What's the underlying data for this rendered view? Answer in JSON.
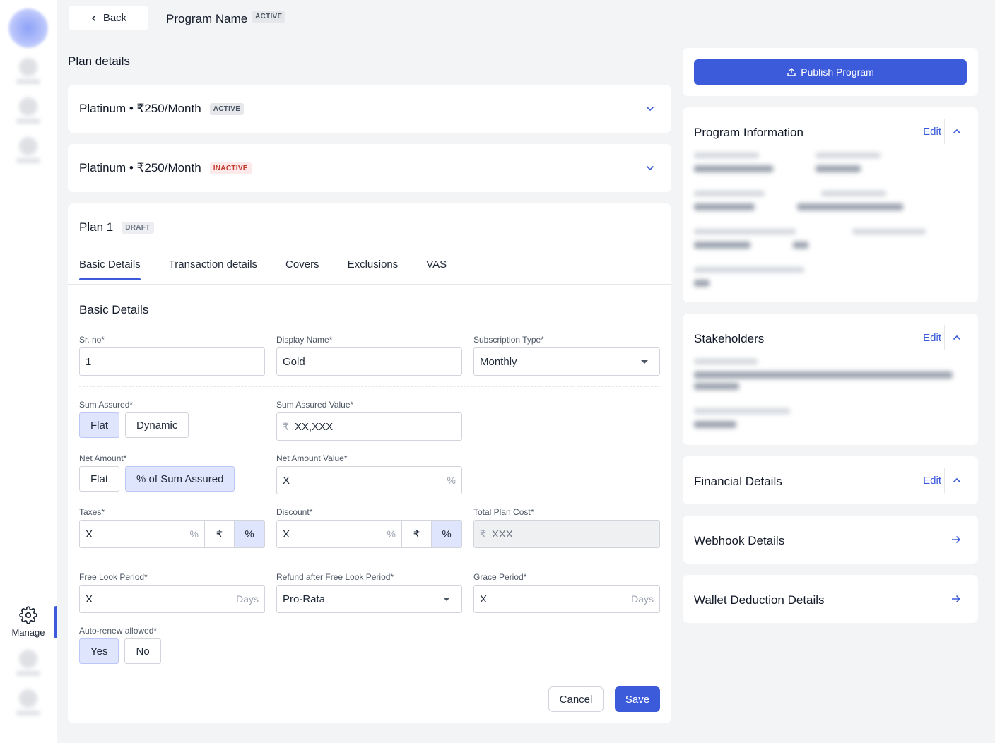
{
  "sidebar": {
    "manage_label": "Manage"
  },
  "header": {
    "back_label": "Back",
    "program_name": "Program Name",
    "program_status": "ACTIVE"
  },
  "plan_details": {
    "section_title": "Plan details",
    "plans": [
      {
        "name": "Platinum • ₹250/Month",
        "status": "ACTIVE"
      },
      {
        "name": "Platinum • ₹250/Month",
        "status": "INACTIVE"
      }
    ]
  },
  "plan1": {
    "title": "Plan 1",
    "status": "DRAFT",
    "tabs": [
      "Basic Details",
      "Transaction details",
      "Covers",
      "Exclusions",
      "VAS"
    ],
    "active_tab": "Basic Details",
    "section_title": "Basic Details",
    "fields": {
      "sr_no": {
        "label": "Sr. no*",
        "value": "1"
      },
      "display_name": {
        "label": "Display Name*",
        "value": "Gold"
      },
      "subscription_type": {
        "label": "Subscription Type*",
        "value": "Monthly"
      },
      "sum_assured": {
        "label": "Sum Assured*",
        "options": [
          "Flat",
          "Dynamic"
        ],
        "selected": "Flat"
      },
      "sum_assured_value": {
        "label": "Sum Assured Value*",
        "prefix": "₹",
        "value": "XX,XXX"
      },
      "net_amount": {
        "label": "Net Amount*",
        "options": [
          "Flat",
          "% of Sum Assured"
        ],
        "selected": "% of Sum Assured"
      },
      "net_amount_value": {
        "label": "Net Amount Value*",
        "value": "X",
        "suffix": "%"
      },
      "taxes": {
        "label": "Taxes*",
        "value": "X",
        "suffix": "%",
        "options": [
          "₹",
          "%"
        ],
        "selected": "%"
      },
      "discount": {
        "label": "Discount*",
        "value": "X",
        "suffix": "%",
        "options": [
          "₹",
          "%"
        ],
        "selected": "%"
      },
      "total_plan_cost": {
        "label": "Total Plan Cost*",
        "prefix": "₹",
        "value": "XXX"
      },
      "free_look_period": {
        "label": "Free Look Period*",
        "value": "X",
        "suffix": "Days"
      },
      "refund_after_free_look": {
        "label": "Refund after Free Look Period*",
        "value": "Pro-Rata"
      },
      "grace_period": {
        "label": "Grace Period*",
        "value": "X",
        "suffix": "Days"
      },
      "auto_renew": {
        "label": "Auto-renew allowed*",
        "options": [
          "Yes",
          "No"
        ],
        "selected": "Yes"
      }
    },
    "cancel_label": "Cancel",
    "save_label": "Save"
  },
  "right_panel": {
    "publish_label": "Publish Program",
    "program_information": {
      "title": "Program Information",
      "edit_label": "Edit"
    },
    "stakeholders": {
      "title": "Stakeholders",
      "edit_label": "Edit"
    },
    "financial_details": {
      "title": "Financial Details",
      "edit_label": "Edit"
    },
    "webhook_details": {
      "title": "Webhook Details"
    },
    "wallet_deduction_details": {
      "title": "Wallet Deduction Details"
    }
  },
  "colors": {
    "accent": "#3b5bdb",
    "selected_bg": "#dfe5fd",
    "inactive_badge_text": "#c0392b"
  }
}
